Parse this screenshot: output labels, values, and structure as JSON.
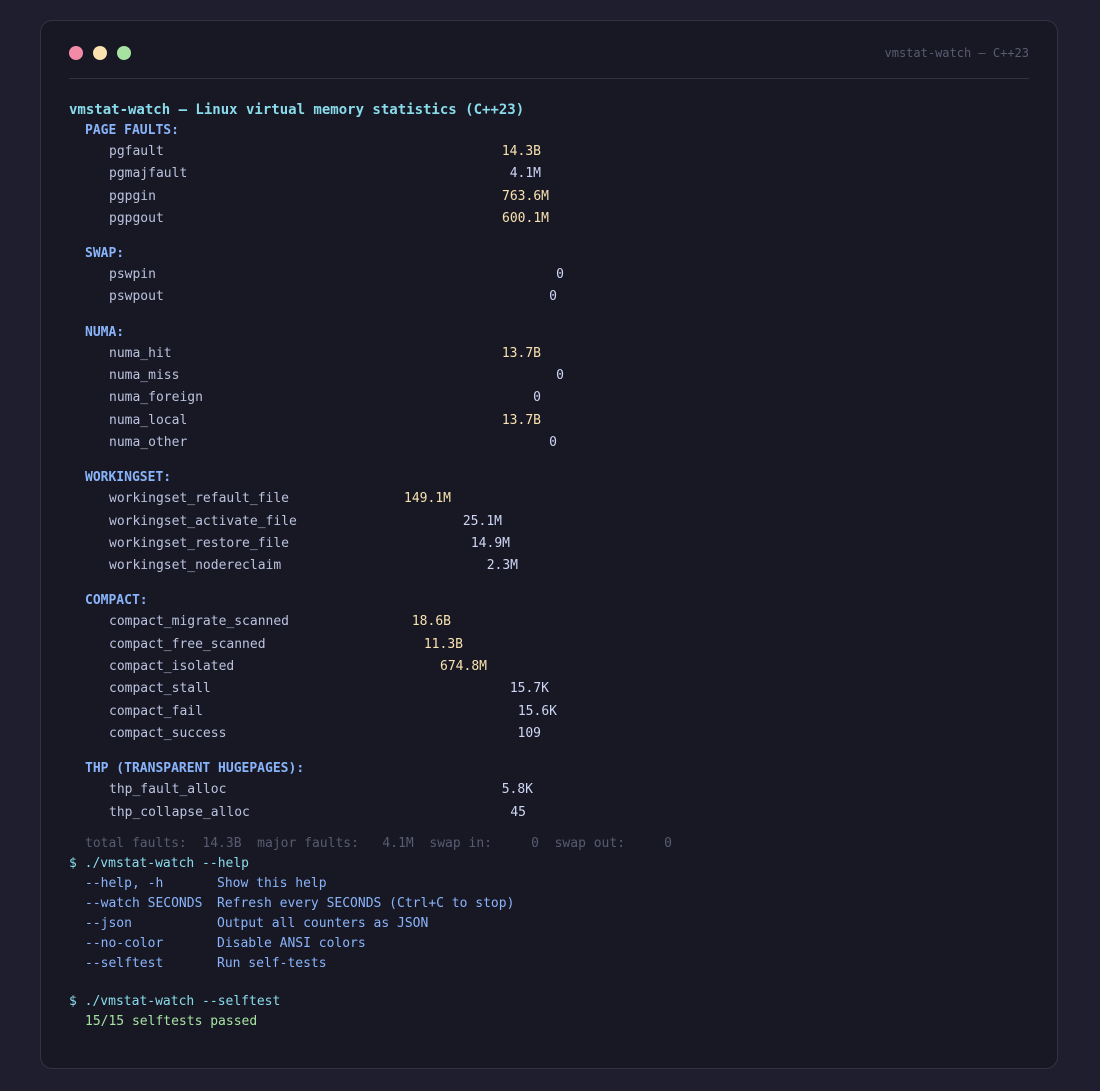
{
  "window": {
    "title": "vmstat-watch — C++23"
  },
  "heading": "vmstat-watch — Linux virtual memory statistics (C++23)",
  "sections": [
    {
      "title": "PAGE FAULTS:",
      "rows": [
        {
          "name": "pgfault",
          "value": "14.3B",
          "big": true
        },
        {
          "name": "pgmajfault",
          "value": "4.1M",
          "big": false
        },
        {
          "name": "pgpgin",
          "value": "763.6M",
          "big": true
        },
        {
          "name": "pgpgout",
          "value": "600.1M",
          "big": true
        }
      ]
    },
    {
      "title": "SWAP:",
      "rows": [
        {
          "name": "pswpin",
          "value": "0",
          "big": false
        },
        {
          "name": "pswpout",
          "value": "0",
          "big": false
        }
      ]
    },
    {
      "title": "NUMA:",
      "rows": [
        {
          "name": "numa_hit",
          "value": "13.7B",
          "big": true
        },
        {
          "name": "numa_miss",
          "value": "0",
          "big": false
        },
        {
          "name": "numa_foreign",
          "value": "0",
          "big": false
        },
        {
          "name": "numa_local",
          "value": "13.7B",
          "big": true
        },
        {
          "name": "numa_other",
          "value": "0",
          "big": false
        }
      ]
    },
    {
      "title": "WORKINGSET:",
      "rows": [
        {
          "name": "workingset_refault_file",
          "value": "149.1M",
          "big": true
        },
        {
          "name": "workingset_activate_file",
          "value": "25.1M",
          "big": false
        },
        {
          "name": "workingset_restore_file",
          "value": "14.9M",
          "big": false
        },
        {
          "name": "workingset_nodereclaim",
          "value": "2.3M",
          "big": false
        }
      ]
    },
    {
      "title": "COMPACT:",
      "rows": [
        {
          "name": "compact_migrate_scanned",
          "value": "18.6B",
          "big": true
        },
        {
          "name": "compact_free_scanned",
          "value": "11.3B",
          "big": true
        },
        {
          "name": "compact_isolated",
          "value": "674.8M",
          "big": true
        },
        {
          "name": "compact_stall",
          "value": "15.7K",
          "big": false
        },
        {
          "name": "compact_fail",
          "value": "15.6K",
          "big": false
        },
        {
          "name": "compact_success",
          "value": "109",
          "big": false
        }
      ]
    },
    {
      "title": "THP (TRANSPARENT HUGEPAGES):",
      "rows": [
        {
          "name": "thp_fault_alloc",
          "value": "5.8K",
          "big": false
        },
        {
          "name": "thp_collapse_alloc",
          "value": "45",
          "big": false
        }
      ]
    }
  ],
  "summary": "total faults:  14.3B  major faults:   4.1M  swap in:     0  swap out:     0",
  "help_command": "$ ./vmstat-watch --help",
  "help_items": [
    {
      "flag": "--help, -h",
      "desc": "Show this help"
    },
    {
      "flag": "--watch SECONDS",
      "desc": "Refresh every SECONDS (Ctrl+C to stop)"
    },
    {
      "flag": "--json",
      "desc": "Output all counters as JSON"
    },
    {
      "flag": "--no-color",
      "desc": "Disable ANSI colors"
    },
    {
      "flag": "--selftest",
      "desc": "Run self-tests"
    }
  ],
  "selftest_command": "$ ./vmstat-watch --selftest",
  "selftest_result": "15/15 selftests passed",
  "colors": {
    "background": "#1e1e2e",
    "window": "#181825",
    "heading": "#89dceb",
    "section": "#89b4fa",
    "highlight_value": "#f9e2af",
    "success": "#a6e3a1",
    "muted": "#585b70"
  }
}
